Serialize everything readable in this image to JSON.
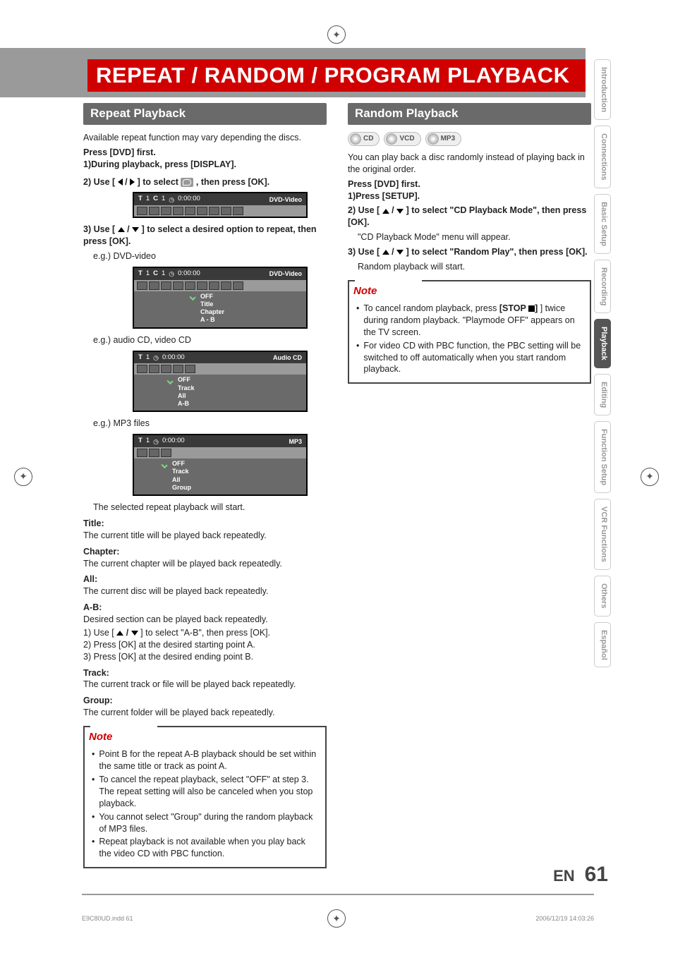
{
  "page_title": "REPEAT / RANDOM / PROGRAM PLAYBACK",
  "repeat": {
    "heading": "Repeat Playback",
    "intro": "Available repeat function may vary depending the discs.",
    "press_first": "Press [DVD] first.",
    "step1": "During playback, press [DISPLAY].",
    "step2_pre": "Use [",
    "step2_post": "] to select ",
    "step2_end": " , then press [OK].",
    "step3_pre": "Use [",
    "step3_mid": " / ",
    "step3_post": "] to select a desired option to repeat, then press [OK].",
    "eg_dvd_label": "e.g.) DVD-video",
    "eg_cd_label": "e.g.) audio CD, video CD",
    "eg_mp3_label": "e.g.) MP3 files",
    "osd1": {
      "t": "T",
      "tnum": "1",
      "c": "C",
      "cnum": "1",
      "time": "0:00:00",
      "type": "DVD-Video"
    },
    "osd2": {
      "t": "T",
      "tnum": "1",
      "c": "C",
      "cnum": "1",
      "time": "0:00:00",
      "type": "DVD-Video",
      "opts": [
        "OFF",
        "Title",
        "Chapter",
        "A - B"
      ]
    },
    "osd3": {
      "t": "T",
      "tnum": "1",
      "time": "0:00:00",
      "type": "Audio CD",
      "opts": [
        "OFF",
        "Track",
        "All",
        "A-B"
      ]
    },
    "osd4": {
      "t": "T",
      "tnum": "1",
      "time": "0:00:00",
      "type": "MP3",
      "opts": [
        "OFF",
        "Track",
        "All",
        "Group"
      ]
    },
    "selected_start": "The selected repeat playback will start.",
    "terms": {
      "title_h": "Title:",
      "title_d": "The current title will be played back repeatedly.",
      "chapter_h": "Chapter:",
      "chapter_d": "The current chapter will be played back repeatedly.",
      "all_h": "All:",
      "all_d": "The current disc will be played back repeatedly.",
      "ab_h": "A-B:",
      "ab_d": "Desired section can be played back repeatedly.",
      "ab_1_pre": "1) Use [",
      "ab_1_post": "] to select \"A-B\", then press [OK].",
      "ab_2": "2) Press [OK] at the desired starting point A.",
      "ab_3": "3) Press [OK] at the desired ending point B.",
      "track_h": "Track:",
      "track_d": "The current track or file will be played back repeatedly.",
      "group_h": "Group:",
      "group_d": "The current folder will be played back repeatedly."
    },
    "note_title": "Note",
    "notes": [
      "Point B for the repeat A-B playback should be set within the same title or track as point A.",
      "To cancel the repeat playback, select \"OFF\" at step 3. The repeat setting will also be canceled when you stop playback.",
      "You cannot select \"Group\" during the random playback of MP3 files.",
      "Repeat playback is not available when you play back the video CD with PBC function."
    ]
  },
  "random": {
    "heading": "Random Playback",
    "discs": [
      "CD",
      "VCD",
      "MP3"
    ],
    "intro": "You can play back a disc randomly instead of playing back in the original order.",
    "press_first": "Press [DVD] first.",
    "step1": "Press [SETUP].",
    "step2_pre": "Use [",
    "step2_post": "] to select \"CD Playback Mode\", then press [OK].",
    "step2_sub": "\"CD Playback Mode\" menu will appear.",
    "step3_pre": "Use [",
    "step3_post": "] to select \"Random Play\", then press [OK].",
    "step3_sub": "Random playback will start.",
    "note_title": "Note",
    "note1_pre": "To cancel random playback, press ",
    "note1_stop": "[STOP ",
    "note1_post": "] twice during random playback. \"Playmode OFF\" appears on the TV screen.",
    "note2": "For video CD with PBC function, the PBC setting will be switched to off automatically when you start random playback."
  },
  "tabs": [
    "Introduction",
    "Connections",
    "Basic Setup",
    "Recording",
    "Playback",
    "Editing",
    "Function Setup",
    "VCR Functions",
    "Others",
    "Español"
  ],
  "active_tab": "Playback",
  "footer": {
    "lang": "EN",
    "page": "61"
  },
  "print": {
    "left": "E9C80UD.indd   61",
    "right": "2006/12/19   14:03:26"
  }
}
